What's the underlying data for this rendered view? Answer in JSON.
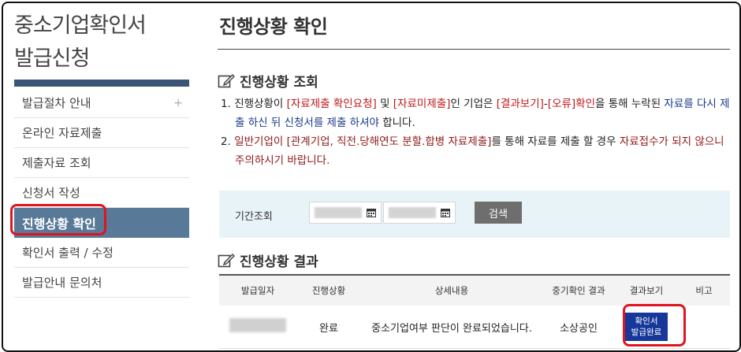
{
  "sidebar": {
    "title_line1": "중소기업확인서",
    "title_line2": "발급신청",
    "items": [
      {
        "label": "발급절차 안내",
        "plus": "+"
      },
      {
        "label": "온라인 자료제출"
      },
      {
        "label": "제출자료 조회"
      },
      {
        "label": "신청서 작성"
      },
      {
        "label": "진행상황 확인",
        "active": true
      },
      {
        "label": "확인서 출력 / 수정"
      },
      {
        "label": "발급안내 문의처"
      }
    ]
  },
  "main": {
    "title": "진행상황 확인",
    "section1": {
      "heading": "진행상황 조회",
      "notice1": {
        "num": "1.",
        "t1": "진행상황이 ",
        "t2": "[자료제출 확인요청]",
        "t3": " 및 ",
        "t4": "[자료미제출]",
        "t5": "인 기업은 ",
        "t6": "[결과보기]",
        "t7": "-",
        "t8": "[오류]",
        "t9": "확인",
        "t10": "을 통해 누락된 ",
        "t11": "자료를 다시 제출 하신 뒤 신청서를 제출 하셔야",
        "t12": " 합니다."
      },
      "notice2": {
        "num": "2.",
        "t1": "일반기업이 ",
        "t2": "[관계기업, 직전.당해연도 분할.합병 자료제출]",
        "t3": "를 통해 자료를 제출 할 경우 ",
        "t4": "자료접수가 되지 않으니 주의하시기 바랍니다."
      }
    },
    "search": {
      "label": "기간조회",
      "button": "검색"
    },
    "section2": {
      "heading": "진행상황 결과",
      "columns": [
        "발급일자",
        "진행상황",
        "상세내용",
        "중기확인 결과",
        "결과보기",
        "비고"
      ],
      "row": {
        "status": "완료",
        "detail": "중소기업여부 판단이 완료되었습니다.",
        "result": "소상공인",
        "button_line1": "확인서",
        "button_line2": "발급완료",
        "note": ""
      }
    }
  },
  "colors": {
    "sidebar_active": "#587a98",
    "sidebar_bar": "#3b5577",
    "highlight_ring": "#e0141e",
    "cert_button": "#17389a",
    "search_bg": "#e8f3f8"
  },
  "icons": {
    "section_icon": "edit-pen-icon",
    "date_icon": "calendar-icon"
  }
}
